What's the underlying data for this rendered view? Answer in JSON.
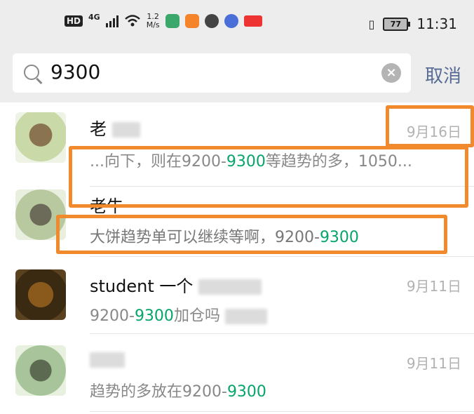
{
  "status_bar": {
    "hd": "HD",
    "network": "4G",
    "speed_value": "1.2",
    "speed_unit": "M/s",
    "battery": "77",
    "time": "11:31"
  },
  "search": {
    "query": "9300",
    "cancel_label": "取消"
  },
  "results": [
    {
      "name": "老",
      "date": "9月16日",
      "snippet_pre": "...向下，则在9200-",
      "snippet_hl": "9300",
      "snippet_post": "等趋势的多，1050..."
    },
    {
      "name": "老牛",
      "date": "",
      "snippet_pre": "大饼趋势单可以继续等啊，9200-",
      "snippet_hl": "9300",
      "snippet_post": ""
    },
    {
      "name": "student 一个",
      "date": "9月11日",
      "snippet_pre": "9200-",
      "snippet_hl": "9300",
      "snippet_post": "加仓吗"
    },
    {
      "name": "",
      "date": "9月11日",
      "snippet_pre": "趋势的多放在9200-",
      "snippet_hl": "9300",
      "snippet_post": ""
    }
  ],
  "colors": {
    "highlight": "#07a56a",
    "cancel": "#576b95",
    "annotation": "#f08a2c"
  }
}
